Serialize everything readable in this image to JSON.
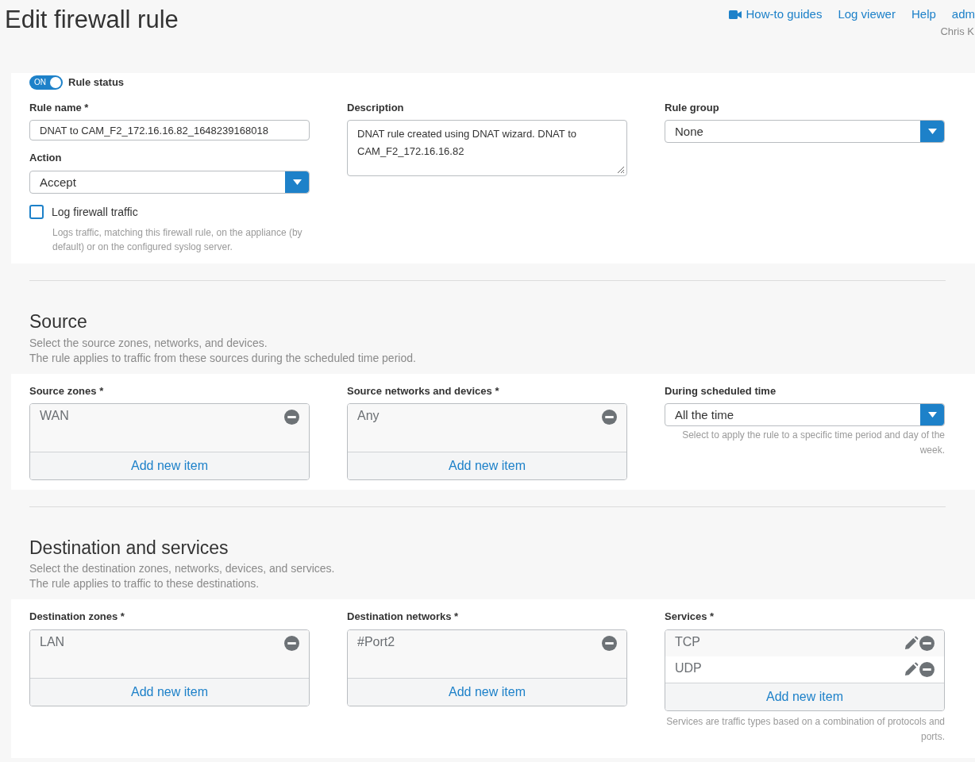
{
  "header": {
    "title": "Edit firewall rule",
    "links": [
      {
        "label": "How-to guides"
      },
      {
        "label": "Log viewer"
      },
      {
        "label": "Help"
      },
      {
        "label": "adm"
      }
    ],
    "user": "Chris K"
  },
  "general": {
    "rule_status": {
      "on": true,
      "switch_label": "ON",
      "label": "Rule status"
    },
    "rule_name": {
      "label": "Rule name *",
      "value": "DNAT to CAM_F2_172.16.16.82_1648239168018"
    },
    "action": {
      "label": "Action",
      "value": "Accept"
    },
    "log_traffic": {
      "label": "Log firewall traffic",
      "checked": false,
      "hint": "Logs traffic, matching this firewall rule, on the appliance (by default) or on the configured syslog server."
    },
    "description": {
      "label": "Description",
      "value": "DNAT rule created using DNAT wizard. DNAT to CAM_F2_172.16.16.82"
    },
    "rule_group": {
      "label": "Rule group",
      "value": "None"
    }
  },
  "sections": [
    {
      "title": "Source",
      "lines": [
        "Select the source zones, networks, and devices.",
        "The rule applies to traffic from these sources during the scheduled time period."
      ],
      "columns": [
        {
          "kind": "list",
          "label": "Source zones *",
          "items": [
            {
              "name": "WAN",
              "editable": false
            }
          ],
          "add_label": "Add new item"
        },
        {
          "kind": "list",
          "label": "Source networks and devices *",
          "items": [
            {
              "name": "Any",
              "editable": false
            }
          ],
          "add_label": "Add new item"
        },
        {
          "kind": "select",
          "label": "During scheduled time",
          "value": "All the time",
          "hint": "Select to apply the rule to a specific time period and day of the week."
        }
      ]
    },
    {
      "title": "Destination and services",
      "lines": [
        "Select the destination zones, networks, devices, and services.",
        "The rule applies to traffic to these destinations."
      ],
      "columns": [
        {
          "kind": "list",
          "label": "Destination zones *",
          "items": [
            {
              "name": "LAN",
              "editable": false
            }
          ],
          "add_label": "Add new item"
        },
        {
          "kind": "list",
          "label": "Destination networks *",
          "items": [
            {
              "name": "#Port2",
              "editable": false
            }
          ],
          "add_label": "Add new item"
        },
        {
          "kind": "list",
          "label": "Services *",
          "items": [
            {
              "name": "TCP",
              "editable": true
            },
            {
              "name": "UDP",
              "editable": true
            }
          ],
          "add_label": "Add new item",
          "hint": "Services are traffic types based on a combination of protocols and ports."
        }
      ]
    }
  ]
}
